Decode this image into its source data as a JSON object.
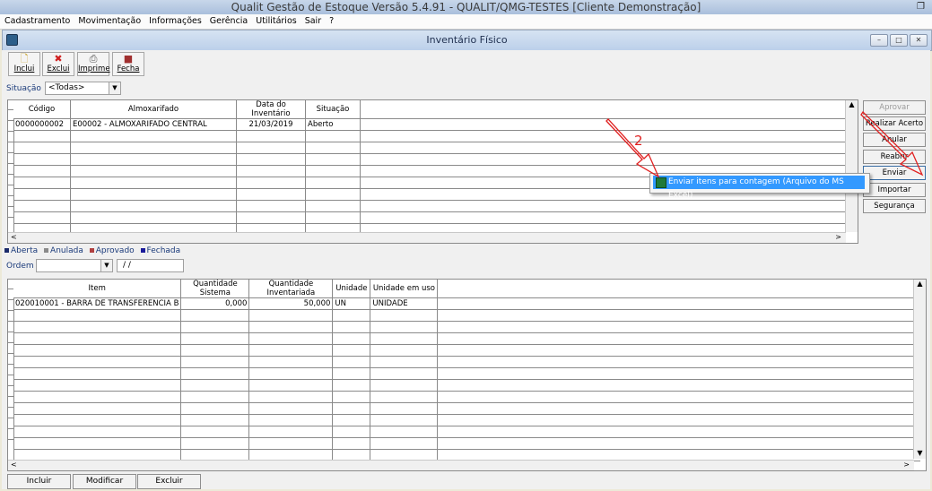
{
  "app": {
    "title": "Qualit Gestão de Estoque Versão 5.4.91 - QUALIT/QMG-TESTES [Cliente Demonstração]"
  },
  "menu": {
    "items": [
      "Cadastramento",
      "Movimentação",
      "Informações",
      "Gerência",
      "Utilitários",
      "Sair",
      "?"
    ]
  },
  "window": {
    "title": "Inventário Físico"
  },
  "toolbar": {
    "buttons": [
      {
        "label": "Inclui",
        "icon": "new-document-icon"
      },
      {
        "label": "Exclui",
        "icon": "delete-x-icon"
      },
      {
        "label": "Imprime",
        "icon": "printer-icon"
      },
      {
        "label": "Fecha",
        "icon": "exit-door-icon"
      }
    ]
  },
  "filter": {
    "label": "Situação",
    "value": "<Todas>"
  },
  "inventory_grid": {
    "columns": [
      "Código",
      "Almoxarifado",
      "Data do Inventário",
      "Situação"
    ],
    "rows": [
      {
        "codigo": "0000000002",
        "almox": "E00002 - ALMOXARIFADO CENTRAL",
        "data": "21/03/2019",
        "situacao": "Aberto"
      }
    ]
  },
  "side_buttons": [
    "Aprovar",
    "Realizar Acerto",
    "Anular",
    "Reabrir",
    "Enviar",
    "Importar",
    "Segurança"
  ],
  "context_menu": {
    "item": "Enviar itens para contagem (Arquivo do MS Excel)"
  },
  "legend": [
    {
      "label": "Aberta",
      "color": "#1a2a6a"
    },
    {
      "label": "Anulada",
      "color": "#8a8a8a"
    },
    {
      "label": "Aprovado",
      "color": "#b04040"
    },
    {
      "label": "Fechada",
      "color": "#1a1a9a"
    }
  ],
  "order": {
    "label": "Ordem",
    "value": "",
    "date": "/ /"
  },
  "items_grid": {
    "columns": [
      "Item",
      "Quantidade Sistema",
      "Quantidade Inventariada",
      "Unidade",
      "Unidade em uso"
    ],
    "rows": [
      {
        "item": "020010001 - BARRA DE TRANSFERENCIA B",
        "qtd_sistema": "0,000",
        "qtd_inv": "50,000",
        "unidade": "UN",
        "unidade_uso": "UNIDADE"
      }
    ]
  },
  "bottom_buttons": [
    "Incluir",
    "Modificar",
    "Excluir"
  ],
  "annotation": {
    "step_label": "2",
    "arrow_color": "#e02020"
  }
}
